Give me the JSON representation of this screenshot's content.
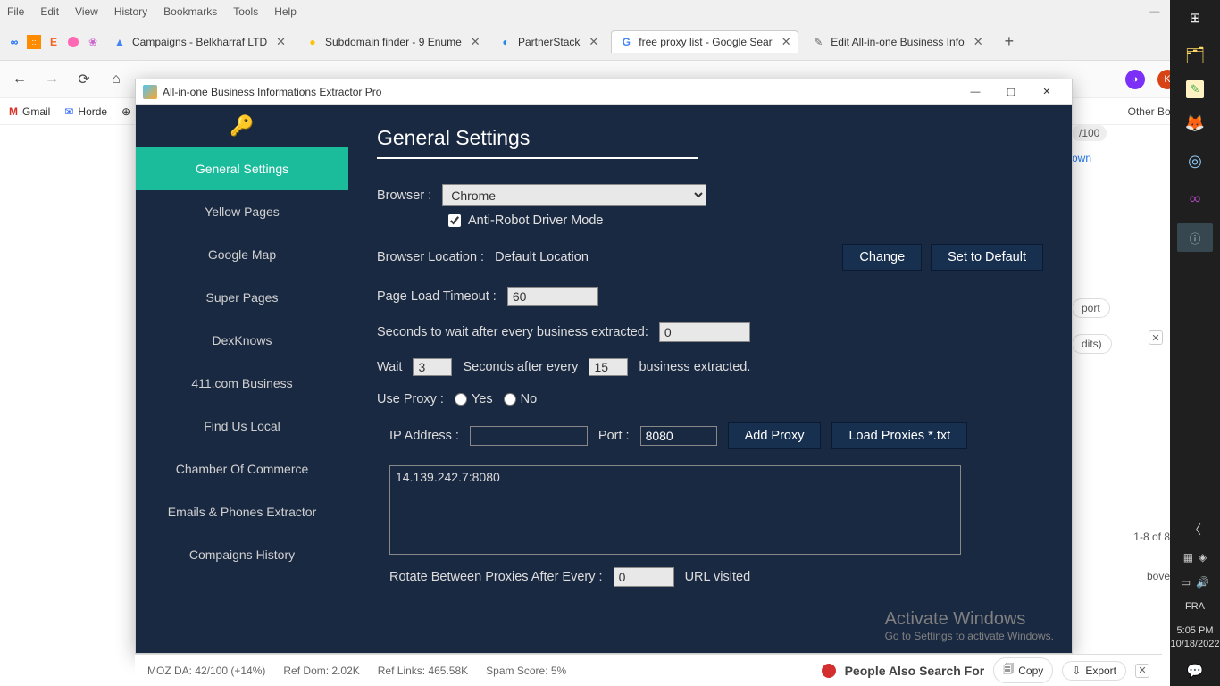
{
  "browser_menu": [
    "File",
    "Edit",
    "View",
    "History",
    "Bookmarks",
    "Tools",
    "Help"
  ],
  "tabs": [
    {
      "label": "Campaigns - Belkharraf LTD"
    },
    {
      "label": "Subdomain finder - 9 Enume"
    },
    {
      "label": "PartnerStack"
    },
    {
      "label": "free proxy list - Google Sear",
      "active": true
    },
    {
      "label": "Edit All-in-one Business Info"
    }
  ],
  "bookmarks": {
    "gmail": "Gmail",
    "horde": "Horde",
    "other": "Other Bookmarks"
  },
  "app": {
    "title": "All-in-one Business Informations Extractor Pro",
    "sidebar": [
      "General Settings",
      "Yellow Pages",
      "Google Map",
      "Super Pages",
      "DexKnows",
      "411.com Business",
      "Find Us Local",
      "Chamber Of Commerce",
      "Emails & Phones Extractor",
      "Compaigns History"
    ],
    "heading": "General Settings",
    "browser_label": "Browser :",
    "browser_value": "Chrome",
    "anti_robot": "Anti-Robot Driver Mode",
    "loc_label": "Browser Location :",
    "loc_value": "Default Location",
    "change": "Change",
    "set_default": "Set to Default",
    "timeout_label": "Page Load Timeout :",
    "timeout_value": "60",
    "wait_after_label": "Seconds to wait after every business extracted:",
    "wait_after_value": "0",
    "wait_label": "Wait",
    "wait_val": "3",
    "sec_after": "Seconds after every",
    "every_val": "15",
    "biz_extracted": "business extracted.",
    "use_proxy": "Use Proxy :",
    "yes": "Yes",
    "no": "No",
    "ip_label": "IP Address :",
    "port_label": "Port :",
    "port_value": "8080",
    "add_proxy": "Add Proxy",
    "load_proxies": "Load Proxies *.txt",
    "proxy_entry": "14.139.242.7:8080",
    "rotate_label": "Rotate Between Proxies After Every :",
    "rotate_value": "0",
    "url_visited": "URL visited",
    "activate": "Activate Windows",
    "activate_sub": "Go to Settings to activate Windows."
  },
  "behind": {
    "badge": "/100",
    "own": "own",
    "port": "port",
    "dits": "dits)",
    "range": "1-8 of 8",
    "bove": "bove"
  },
  "bottom": {
    "moz": "MOZ DA: 42/100 (+14%)",
    "refdom": "Ref Dom: 2.02K",
    "reflinks": "Ref Links: 465.58K",
    "spam": "Spam Score: 5%",
    "people": "People Also Search For",
    "copy": "Copy",
    "export": "Export"
  },
  "taskbar": {
    "lang": "FRA",
    "time": "5:05 PM",
    "date": "10/18/2022"
  }
}
